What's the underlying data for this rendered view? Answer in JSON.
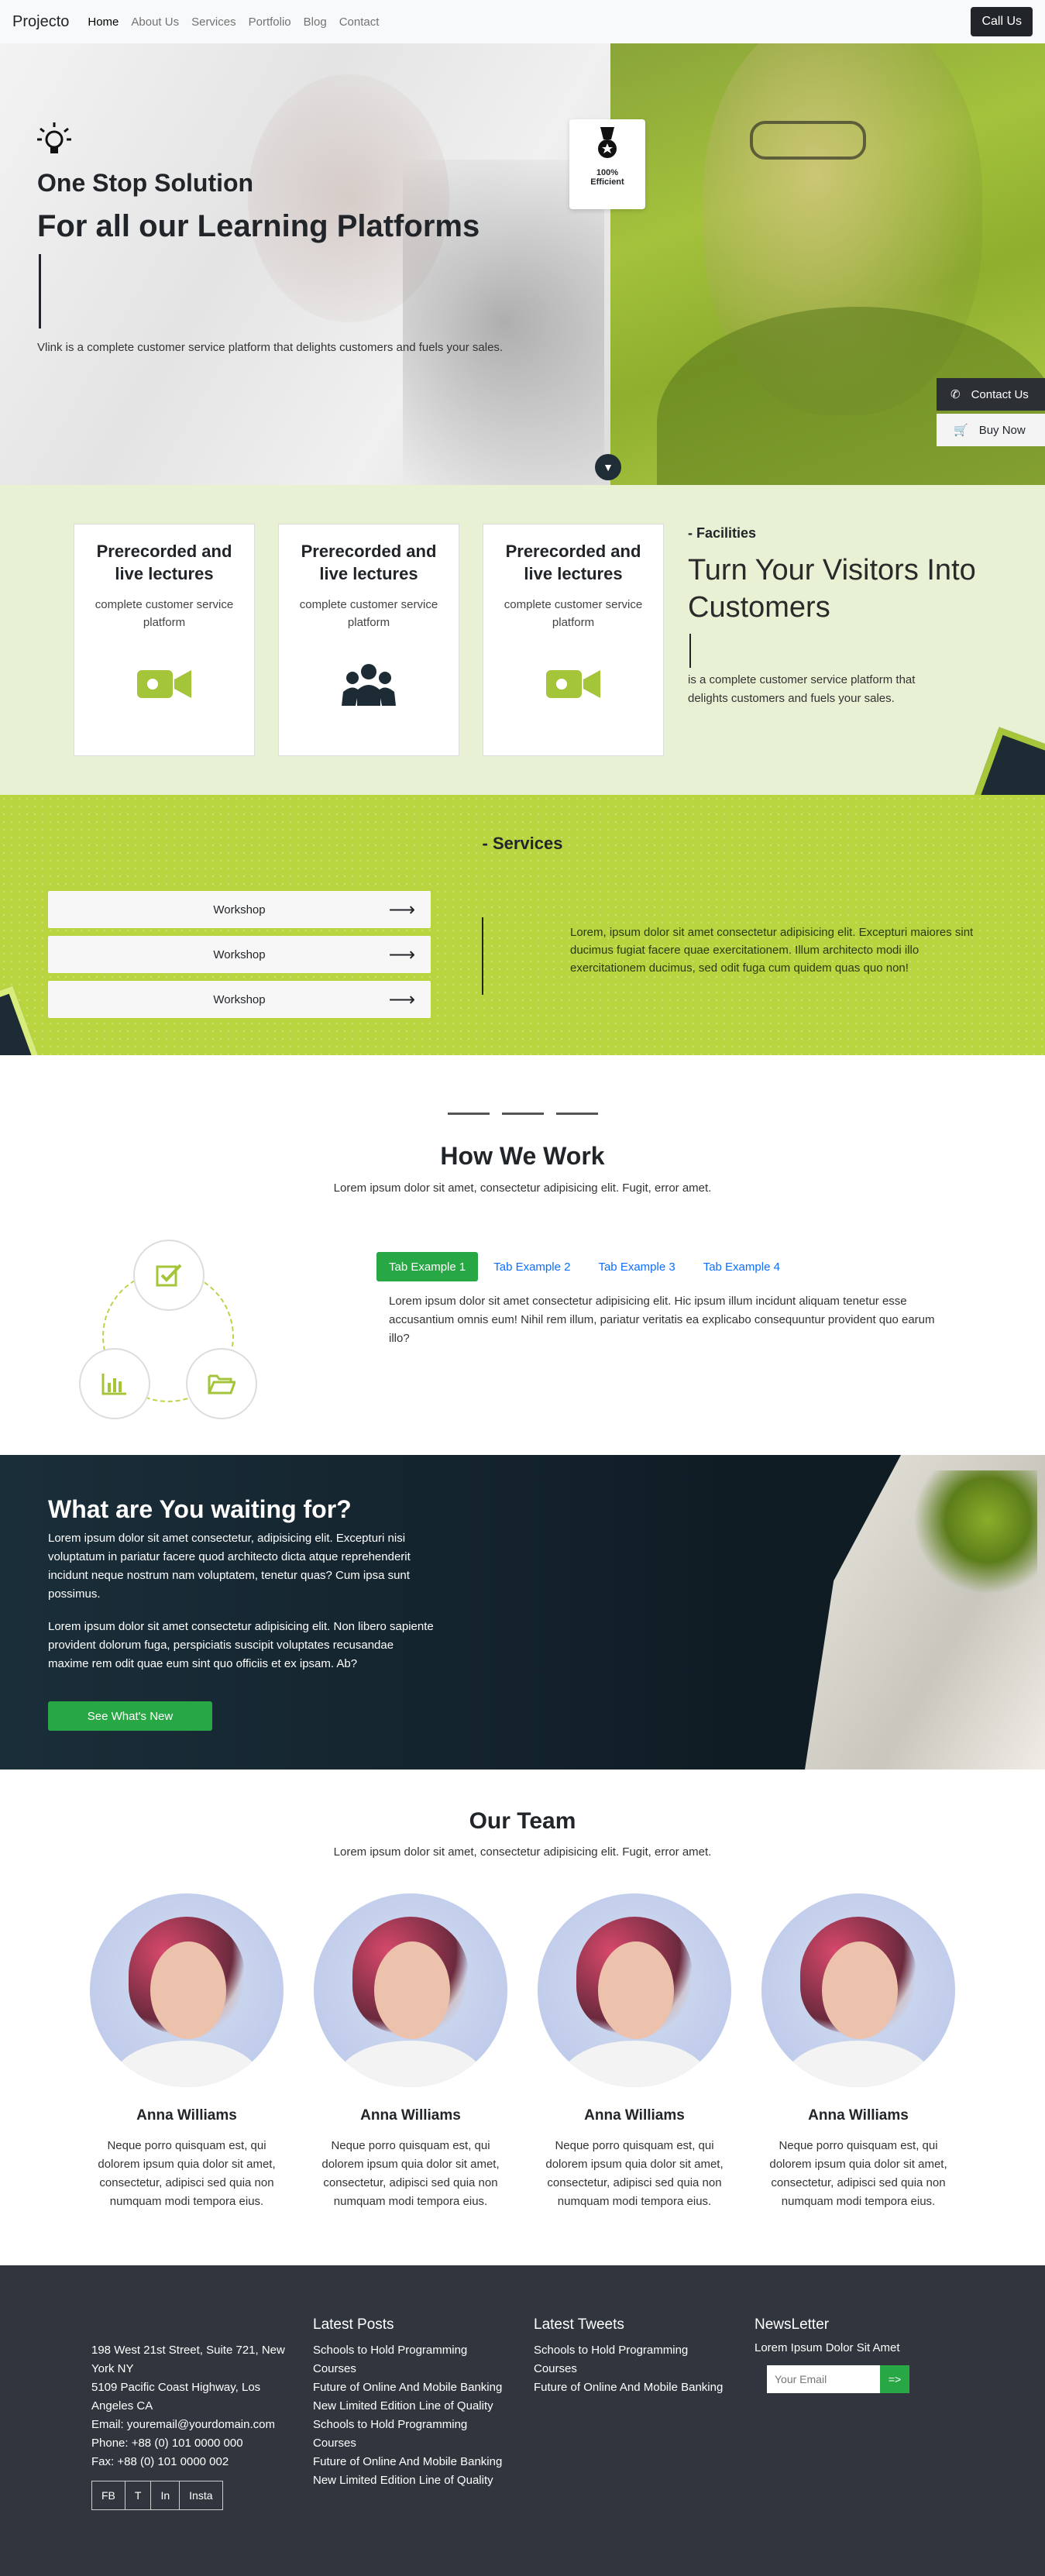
{
  "nav": {
    "brand": "Projecto",
    "links": [
      "Home",
      "About Us",
      "Services",
      "Portfolio",
      "Blog",
      "Contact"
    ],
    "call_label": "Call Us"
  },
  "hero": {
    "icon": "lightbulb-icon",
    "subtitle": "One Stop Solution",
    "title": "For all our Learning Platforms",
    "description": "Vlink is a complete customer service platform that delights customers and fuels your sales.",
    "badge_line1": "100%",
    "badge_line2": "Efficient",
    "contact_label": "Contact Us",
    "buy_label": "Buy Now"
  },
  "facilities": {
    "cards": [
      {
        "title": "Prerecorded and live lectures",
        "text": "complete customer service platform",
        "icon": "video-camera-icon"
      },
      {
        "title": "Prerecorded and live lectures",
        "text": "complete customer service platform",
        "icon": "users-icon"
      },
      {
        "title": "Prerecorded and live lectures",
        "text": "complete customer service platform",
        "icon": "video-camera-icon"
      }
    ],
    "label": "- Facilities",
    "title": "Turn Your Visitors Into Customers",
    "description": "is a complete customer service platform that delights customers and fuels your sales."
  },
  "services": {
    "title": "- Services",
    "items": [
      "Workshop",
      "Workshop",
      "Workshop"
    ],
    "text": "Lorem, ipsum dolor sit amet consectetur adipisicing elit. Excepturi maiores sint ducimus fugiat facere quae exercitationem. Illum architecto modi illo exercitationem ducimus, sed odit fuga cum quidem quas quo non!"
  },
  "how": {
    "title": "How We Work",
    "subtitle": "Lorem ipsum dolor sit amet, consectetur adipisicing elit. Fugit, error amet.",
    "tabs": [
      "Tab Example 1",
      "Tab Example 2",
      "Tab Example 3",
      "Tab Example 4"
    ],
    "tab_content": "Lorem ipsum dolor sit amet consectetur adipisicing elit. Hic ipsum illum incidunt aliquam tenetur esse accusantium omnis eum! Nihil rem illum, pariatur veritatis ea explicabo consequuntur provident quo earum illo?",
    "nodes": [
      "checkbox-icon",
      "bar-chart-icon",
      "folder-open-icon"
    ]
  },
  "cta": {
    "title": "What are You waiting for?",
    "para1": "Lorem ipsum dolor sit amet consectetur, adipisicing elit. Excepturi nisi voluptatum in pariatur facere quod architecto dicta atque reprehenderit incidunt neque nostrum nam voluptatem, tenetur quas? Cum ipsa sunt possimus.",
    "para2": "Lorem ipsum dolor sit amet consectetur adipisicing elit. Non libero sapiente provident dolorum fuga, perspiciatis suscipit voluptates recusandae maxime rem odit quae eum sint quo officiis et ex ipsam. Ab?",
    "button": "See What's New"
  },
  "team": {
    "title": "Our Team",
    "subtitle": "Lorem ipsum dolor sit amet, consectetur adipisicing elit. Fugit, error amet.",
    "members": [
      {
        "name": "Anna Williams",
        "bio": "Neque porro quisquam est, qui dolorem ipsum quia dolor sit amet, consectetur, adipisci sed quia non numquam modi tempora eius."
      },
      {
        "name": "Anna Williams",
        "bio": "Neque porro quisquam est, qui dolorem ipsum quia dolor sit amet, consectetur, adipisci sed quia non numquam modi tempora eius."
      },
      {
        "name": "Anna Williams",
        "bio": "Neque porro quisquam est, qui dolorem ipsum quia dolor sit amet, consectetur, adipisci sed quia non numquam modi tempora eius."
      },
      {
        "name": "Anna Williams",
        "bio": "Neque porro quisquam est, qui dolorem ipsum quia dolor sit amet, consectetur, adipisci sed quia non numquam modi tempora eius."
      }
    ]
  },
  "footer": {
    "address_lines": [
      "198 West 21st Street, Suite 721, New York NY",
      "5109 Pacific Coast Highway, Los Angeles CA",
      "Email: youremail@yourdomain.com",
      "Phone: +88 (0) 101 0000 000",
      "Fax: +88 (0) 101 0000 002"
    ],
    "social": [
      "FB",
      "T",
      "In",
      "Insta"
    ],
    "posts_title": "Latest Posts",
    "posts": [
      "Schools to Hold Programming Courses",
      "Future of Online And Mobile Banking",
      "New Limited Edition Line of Quality",
      "Schools to Hold Programming Courses",
      "Future of Online And Mobile Banking",
      "New Limited Edition Line of Quality"
    ],
    "tweets_title": "Latest Tweets",
    "tweets": [
      "Schools to Hold Programming Courses",
      "Future of Online And Mobile Banking"
    ],
    "newsletter_title": "NewsLetter",
    "newsletter_text": "Lorem Ipsum Dolor Sit Amet",
    "email_placeholder": "Your Email",
    "submit_label": "=>"
  },
  "colors": {
    "accent_green": "#28a745",
    "lime": "#b8d540",
    "dark_navy": "#13222c",
    "footer_bg": "#31353d"
  }
}
